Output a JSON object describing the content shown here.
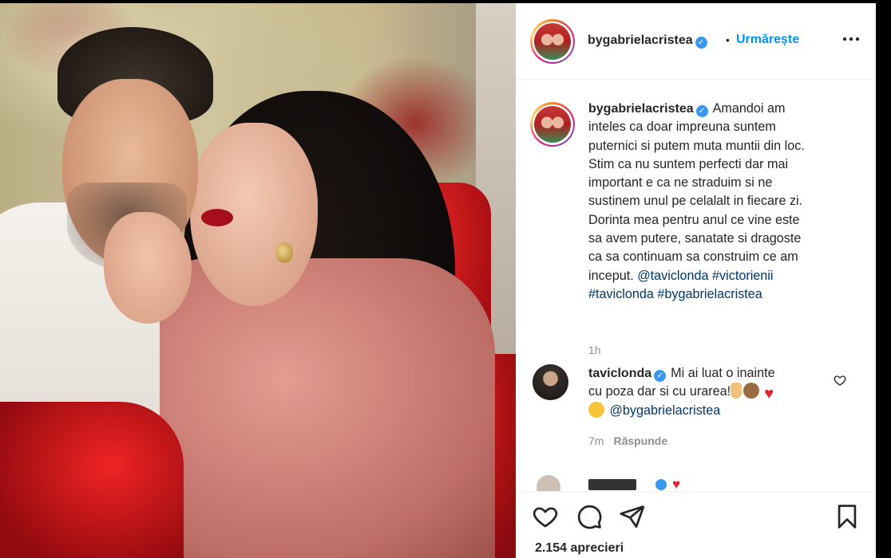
{
  "post": {
    "author": "bygabrielacristea",
    "follow_label": "Urmărește",
    "header_dot": "•",
    "more_icon": "more-horizontal-icon",
    "caption": {
      "text": "Amandoi am\ninteles ca doar impreuna suntem\nputernici si putem muta muntii din loc.\nStim ca nu suntem perfecti dar mai\nimportant e ca ne straduim si ne\nsustinem unul pe celalalt in fiecare zi.\nDorinta mea pentru anul ce vine este\nsa avem putere, sanatate si dragoste\nca sa continuam sa construim ce am\ninceput. ",
      "tags": [
        "@taviclonda",
        "#victorienii",
        "#taviclonda",
        "#bygabrielacristea"
      ],
      "time": "1h"
    },
    "comments": [
      {
        "author": "taviclonda",
        "text_line1": "Mi ai luat o inainte",
        "text_line2": "cu poza dar si cu urarea!",
        "mention": "@bygabrielacristea",
        "time": "7m",
        "reply_label": "Răspunde"
      }
    ],
    "likes": "2.154 aprecieri"
  },
  "colors": {
    "accent": "#0095f6",
    "verified": "#3897f0",
    "mention": "#00376b",
    "muted": "#8e8e8e"
  }
}
